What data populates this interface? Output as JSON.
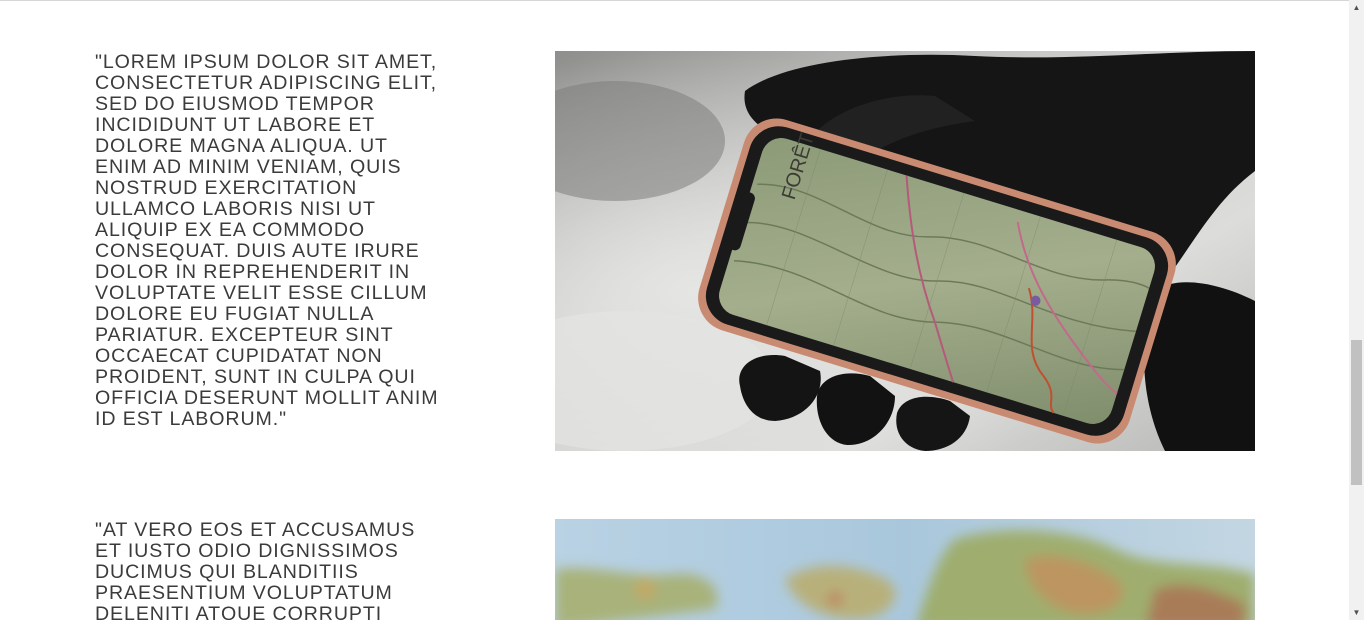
{
  "quotes": [
    {
      "text": "\"LOREM IPSUM DOLOR SIT AMET, CONSECTETUR ADIPISCING ELIT, SED DO EIUSMOD TEMPOR INCIDIDUNT UT LABORE ET DOLORE MAGNA ALIQUA. UT ENIM AD MINIM VENIAM, QUIS NOSTRUD EXERCITATION ULLAMCO LABORIS NISI UT ALIQUIP EX EA COMMODO CONSEQUAT. DUIS AUTE IRURE DOLOR IN REPREHENDERIT IN VOLUPTATE VELIT ESSE CILLUM DOLORE EU FUGIAT NULLA PARIATUR. EXCEPTEUR SINT OCCAECAT CUPIDATAT NON PROIDENT, SUNT IN CULPA QUI OFFICIA DESERUNT MOLLIT ANIM ID EST LABORUM.\"",
      "image": "gloved-hand-holding-phone-map-photo"
    },
    {
      "text": "\"AT VERO EOS ET ACCUSAMUS ET IUSTO ODIO DIGNISSIMOS DUCIMUS QUI BLANDITIIS PRAESENTIUM VOLUPTATUM DELENITI ATQUE CORRUPTI",
      "image": "blurred-world-map-photo"
    }
  ],
  "phone_map_label": "FORÊT",
  "scrollbar": {
    "up_icon": "arrow-up-icon",
    "down_icon": "arrow-down-icon"
  }
}
